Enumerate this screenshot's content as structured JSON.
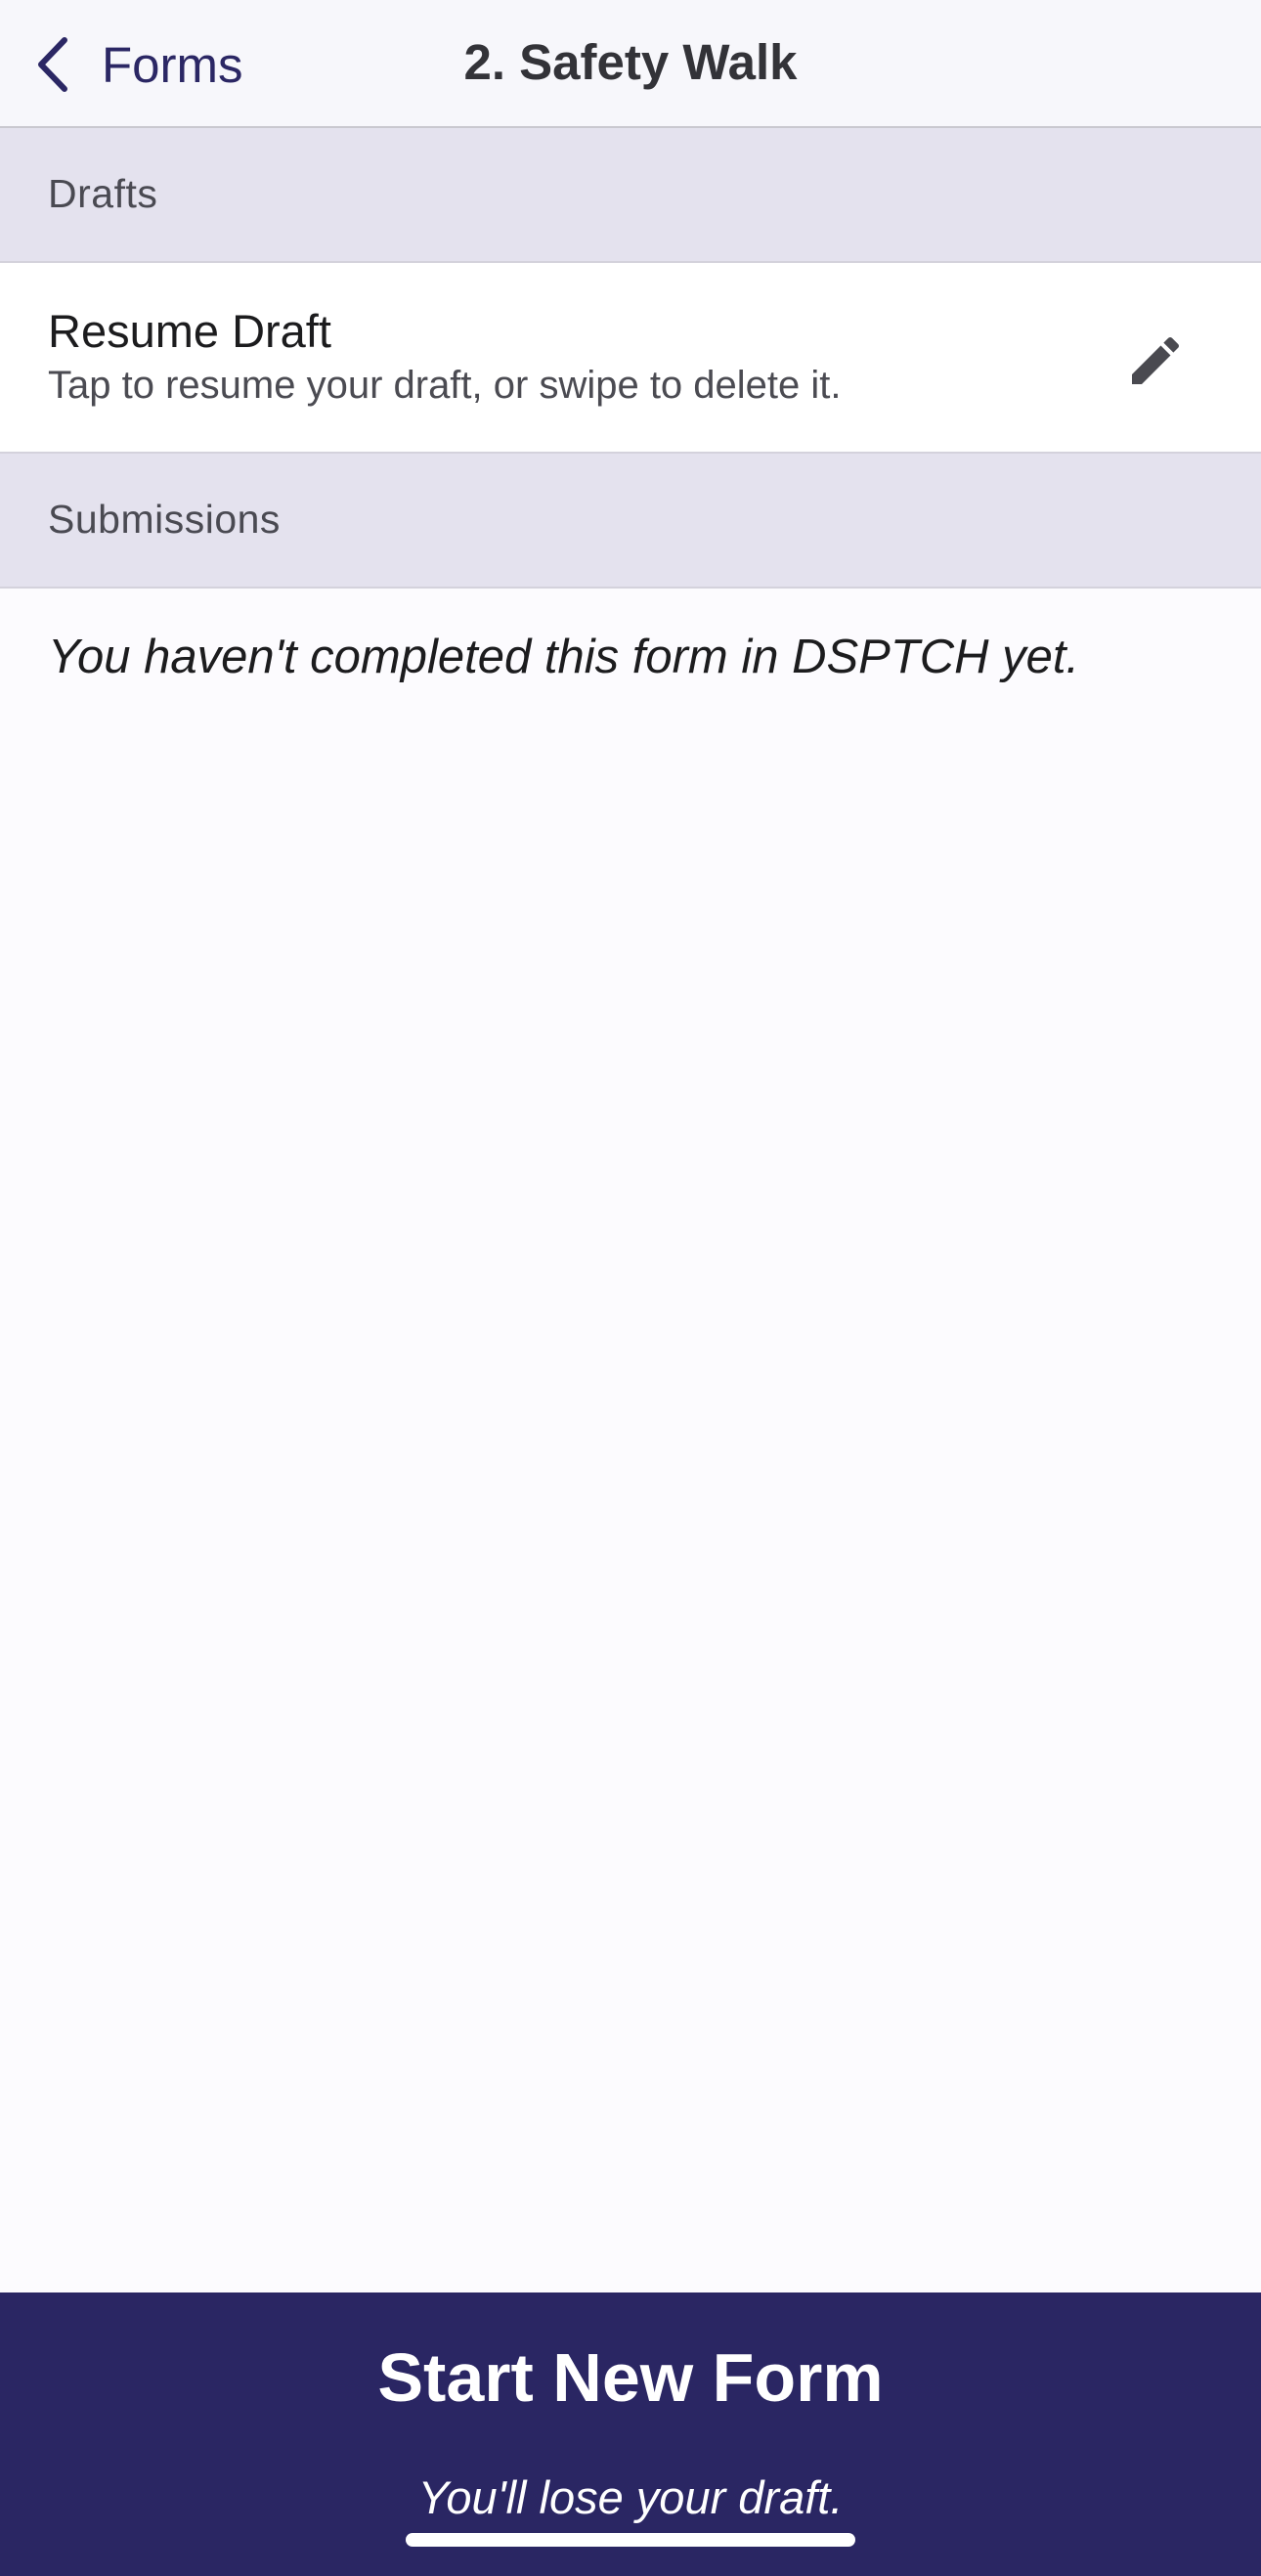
{
  "nav": {
    "back_label": "Forms",
    "title": "2. Safety Walk",
    "back_icon": "chevron-left-icon"
  },
  "sections": {
    "drafts_header": "Drafts",
    "submissions_header": "Submissions"
  },
  "draft": {
    "title": "Resume Draft",
    "subtitle": "Tap to resume your draft, or swipe to delete it.",
    "icon": "pencil-icon"
  },
  "submissions": {
    "empty_text": "You haven't completed this form in DSPTCH yet."
  },
  "footer": {
    "start_label": "Start New Form",
    "warning": "You'll lose your draft."
  },
  "colors": {
    "accent": "#2b2764",
    "footer_bg": "#2a2663",
    "section_bg": "#e4e2ee",
    "nav_bg": "#f7f7fb"
  }
}
